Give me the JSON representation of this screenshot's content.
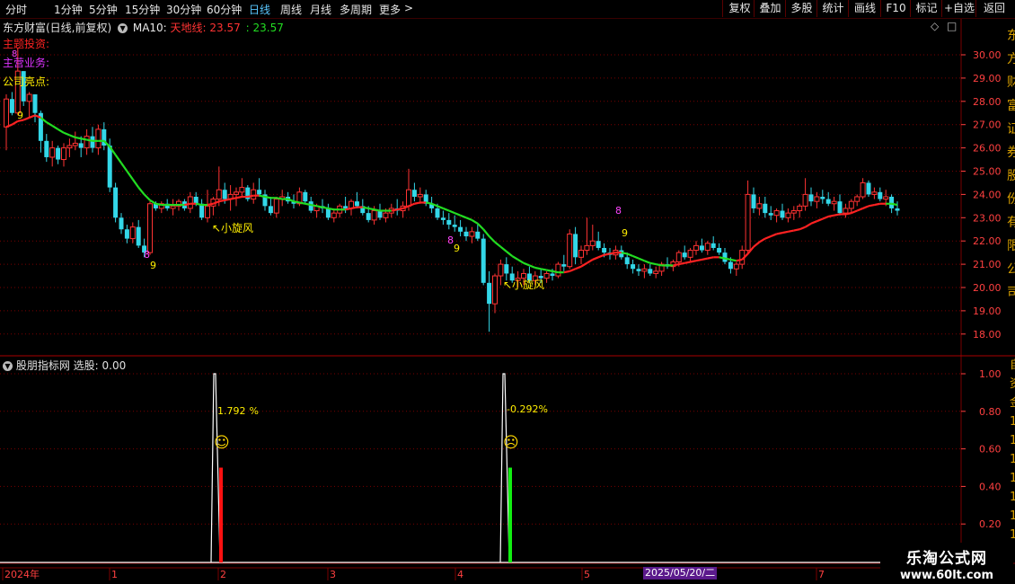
{
  "toolbar": {
    "periods": [
      "分时",
      "1分钟",
      "5分钟",
      "15分钟",
      "30分钟",
      "60分钟",
      "日线",
      "周线",
      "月线",
      "多周期",
      "更多"
    ],
    "active_period": "日线",
    "more_arrow": ">",
    "right_buttons": [
      "复权",
      "叠加",
      "多股",
      "统计",
      "画线",
      "F10",
      "标记",
      "+自选",
      "返回"
    ]
  },
  "chart_header": {
    "stock_title": "东方财富(日线,前复权)",
    "ma_label": "MA10:",
    "tiandi_label": "天地线:",
    "tiandi_value": "23.57",
    "ma_value_sep": ":",
    "ma_value": "23.57",
    "diamond_icon": "◇",
    "box_icon": "□"
  },
  "info_labels": {
    "theme": "主题投资:",
    "business": "主营业务:",
    "highlights": "公司亮点:"
  },
  "right_side_text": [
    "东",
    "方",
    "财",
    "富",
    "证",
    "券",
    "股",
    "份",
    "有",
    "限",
    "公",
    "司"
  ],
  "price_axis": [
    "30.00",
    "29.00",
    "28.00",
    "27.00",
    "26.00",
    "25.00",
    "24.00",
    "23.00",
    "22.00",
    "21.00",
    "20.00",
    "19.00",
    "18.00"
  ],
  "annotations": {
    "nine_top": "9",
    "eight_top": "8",
    "eight_a": "8",
    "nine_a": "9",
    "xuanfeng_a": "↖小旋风",
    "eight_b": "8",
    "nine_b": "9",
    "xuanfeng_b": "↖小旋风",
    "eight_c": "8",
    "nine_c": "9"
  },
  "indicator": {
    "title": "股朋指标网",
    "select_label": "选股:",
    "select_value": "0.00",
    "axis": [
      "1.00",
      "0.80",
      "0.60",
      "0.40",
      "0.20"
    ],
    "signal_a_pct": "1.792",
    "signal_b_pct": "-0.292",
    "pct_unit": "%",
    "smile_icon": "☺",
    "frown_icon": "☹",
    "side_chars": [
      "自",
      "资",
      "金",
      "1",
      "1",
      "1",
      "1",
      "1",
      "1",
      "1"
    ]
  },
  "date_axis": {
    "labels": [
      "2024年",
      "1",
      "2",
      "3",
      "4",
      "5",
      "7"
    ],
    "highlight": "2025/05/20/二"
  },
  "watermark": {
    "line1": "乐淘公式网",
    "line2": "www.60lt.com"
  },
  "colors": {
    "up": "#ff3333",
    "down": "#33d7e8",
    "ma_green": "#22dd22",
    "ma_red": "#ff2222",
    "grid": "#7a0000",
    "axis_text": "#ff4040"
  },
  "candles": [
    [
      26.9,
      28.3,
      25.9,
      28.1
    ],
    [
      28.1,
      28.4,
      27.4,
      27.5
    ],
    [
      27.5,
      30.3,
      27.4,
      29.3
    ],
    [
      29.3,
      29.3,
      27.8,
      28.0
    ],
    [
      28.0,
      28.4,
      27.3,
      28.3
    ],
    [
      28.3,
      28.3,
      27.1,
      27.5
    ],
    [
      27.5,
      27.6,
      25.8,
      26.3
    ],
    [
      26.3,
      26.6,
      25.4,
      25.6
    ],
    [
      25.6,
      26.3,
      25.2,
      26.0
    ],
    [
      26.0,
      26.1,
      25.3,
      25.5
    ],
    [
      25.5,
      26.2,
      25.2,
      26.0
    ],
    [
      26.0,
      26.4,
      25.6,
      26.1
    ],
    [
      26.1,
      26.7,
      25.9,
      26.2
    ],
    [
      26.2,
      26.5,
      25.6,
      26.0
    ],
    [
      26.0,
      26.8,
      25.7,
      26.5
    ],
    [
      26.5,
      26.9,
      25.8,
      26.0
    ],
    [
      26.0,
      27.0,
      25.7,
      26.8
    ],
    [
      26.8,
      27.1,
      25.9,
      26.1
    ],
    [
      26.1,
      26.4,
      24.1,
      24.3
    ],
    [
      24.3,
      24.5,
      22.8,
      23.0
    ],
    [
      23.0,
      23.2,
      22.3,
      22.5
    ],
    [
      22.5,
      22.7,
      21.9,
      22.1
    ],
    [
      22.1,
      22.8,
      21.9,
      22.6
    ],
    [
      22.6,
      22.9,
      21.7,
      21.8
    ],
    [
      21.8,
      22.1,
      21.3,
      21.5
    ],
    [
      21.5,
      23.7,
      21.4,
      23.6
    ],
    [
      23.6,
      23.7,
      23.3,
      23.4
    ],
    [
      23.4,
      23.7,
      23.2,
      23.6
    ],
    [
      23.6,
      23.8,
      23.3,
      23.4
    ],
    [
      23.4,
      23.8,
      23.1,
      23.5
    ],
    [
      23.5,
      23.8,
      23.3,
      23.7
    ],
    [
      23.7,
      23.8,
      23.3,
      23.4
    ],
    [
      23.4,
      24.1,
      23.2,
      23.9
    ],
    [
      23.9,
      24.1,
      23.5,
      23.6
    ],
    [
      23.6,
      23.8,
      22.9,
      23.0
    ],
    [
      23.0,
      24.2,
      22.8,
      23.5
    ],
    [
      23.5,
      23.9,
      23.1,
      23.8
    ],
    [
      23.8,
      25.2,
      23.5,
      24.2
    ],
    [
      24.2,
      24.5,
      23.6,
      23.8
    ],
    [
      23.8,
      24.4,
      23.3,
      24.0
    ],
    [
      24.0,
      24.3,
      23.5,
      24.1
    ],
    [
      24.1,
      24.7,
      23.9,
      24.3
    ],
    [
      24.3,
      24.4,
      23.7,
      23.8
    ],
    [
      23.8,
      24.5,
      23.6,
      24.2
    ],
    [
      24.2,
      24.7,
      23.9,
      24.0
    ],
    [
      24.0,
      24.2,
      23.3,
      23.5
    ],
    [
      23.5,
      23.9,
      23.1,
      23.2
    ],
    [
      23.2,
      23.9,
      23.0,
      23.8
    ],
    [
      23.8,
      24.2,
      23.5,
      23.9
    ],
    [
      23.9,
      24.1,
      23.6,
      23.7
    ],
    [
      23.7,
      24.0,
      23.4,
      23.6
    ],
    [
      23.6,
      24.3,
      23.5,
      24.1
    ],
    [
      24.1,
      24.2,
      23.6,
      23.7
    ],
    [
      23.7,
      23.9,
      23.2,
      23.3
    ],
    [
      23.3,
      23.6,
      23.0,
      23.5
    ],
    [
      23.5,
      23.8,
      23.2,
      23.4
    ],
    [
      23.4,
      23.6,
      22.9,
      23.0
    ],
    [
      23.0,
      23.4,
      22.8,
      23.2
    ],
    [
      23.2,
      23.6,
      23.0,
      23.5
    ],
    [
      23.5,
      23.9,
      23.2,
      23.4
    ],
    [
      23.4,
      23.8,
      23.1,
      23.7
    ],
    [
      23.7,
      24.1,
      23.4,
      23.5
    ],
    [
      23.5,
      23.8,
      23.1,
      23.2
    ],
    [
      23.2,
      23.5,
      22.8,
      22.9
    ],
    [
      22.9,
      23.5,
      22.7,
      23.3
    ],
    [
      23.3,
      23.6,
      22.9,
      23.0
    ],
    [
      23.0,
      23.4,
      22.8,
      23.2
    ],
    [
      23.2,
      23.6,
      23.0,
      23.4
    ],
    [
      23.4,
      23.8,
      23.1,
      23.3
    ],
    [
      23.3,
      23.7,
      23.0,
      23.5
    ],
    [
      23.5,
      25.1,
      23.3,
      24.2
    ],
    [
      24.2,
      24.5,
      23.7,
      23.9
    ],
    [
      23.9,
      24.3,
      23.6,
      24.0
    ],
    [
      24.0,
      24.2,
      23.5,
      23.6
    ],
    [
      23.6,
      23.9,
      23.2,
      23.4
    ],
    [
      23.4,
      23.6,
      22.9,
      23.0
    ],
    [
      23.0,
      23.3,
      22.7,
      22.9
    ],
    [
      22.9,
      23.2,
      22.5,
      22.7
    ],
    [
      22.7,
      23.1,
      22.4,
      22.6
    ],
    [
      22.6,
      22.9,
      22.2,
      22.4
    ],
    [
      22.4,
      22.6,
      22.0,
      22.2
    ],
    [
      22.2,
      22.6,
      21.9,
      22.4
    ],
    [
      22.4,
      22.7,
      22.0,
      22.1
    ],
    [
      22.1,
      22.3,
      20.1,
      20.2
    ],
    [
      20.2,
      20.7,
      18.1,
      19.3
    ],
    [
      19.3,
      20.6,
      18.9,
      20.5
    ],
    [
      20.5,
      21.2,
      20.1,
      21.0
    ],
    [
      21.0,
      21.3,
      20.3,
      20.6
    ],
    [
      20.6,
      20.9,
      20.2,
      20.3
    ],
    [
      20.3,
      20.7,
      20.0,
      20.4
    ],
    [
      20.4,
      20.8,
      20.1,
      20.6
    ],
    [
      20.6,
      20.9,
      20.2,
      20.3
    ],
    [
      20.3,
      20.7,
      20.1,
      20.5
    ],
    [
      20.5,
      20.8,
      20.2,
      20.4
    ],
    [
      20.4,
      20.7,
      20.2,
      20.6
    ],
    [
      20.6,
      20.8,
      20.3,
      20.5
    ],
    [
      20.5,
      21.1,
      20.4,
      21.0
    ],
    [
      21.0,
      21.4,
      20.7,
      20.9
    ],
    [
      20.9,
      22.5,
      20.8,
      22.3
    ],
    [
      22.3,
      22.6,
      21.0,
      21.3
    ],
    [
      21.3,
      21.8,
      21.0,
      21.6
    ],
    [
      21.6,
      23.0,
      21.4,
      21.8
    ],
    [
      21.8,
      22.7,
      21.6,
      22.0
    ],
    [
      22.0,
      22.4,
      21.6,
      21.7
    ],
    [
      21.7,
      21.9,
      21.3,
      21.5
    ],
    [
      21.5,
      21.7,
      21.2,
      21.4
    ],
    [
      21.4,
      21.8,
      21.2,
      21.6
    ],
    [
      21.6,
      21.8,
      21.2,
      21.3
    ],
    [
      21.3,
      21.5,
      20.8,
      21.0
    ],
    [
      21.0,
      21.2,
      20.6,
      20.8
    ],
    [
      20.8,
      21.0,
      20.5,
      20.7
    ],
    [
      20.7,
      21.0,
      20.4,
      20.8
    ],
    [
      20.8,
      21.0,
      20.5,
      20.6
    ],
    [
      20.6,
      20.9,
      20.4,
      20.7
    ],
    [
      20.7,
      21.1,
      20.5,
      21.0
    ],
    [
      21.0,
      21.3,
      20.8,
      20.9
    ],
    [
      20.9,
      21.2,
      20.7,
      21.1
    ],
    [
      21.1,
      21.6,
      20.9,
      21.5
    ],
    [
      21.5,
      21.8,
      21.2,
      21.3
    ],
    [
      21.3,
      21.7,
      21.1,
      21.6
    ],
    [
      21.6,
      22.0,
      21.4,
      21.8
    ],
    [
      21.8,
      22.1,
      21.5,
      21.6
    ],
    [
      21.6,
      22.0,
      21.4,
      21.9
    ],
    [
      21.9,
      22.2,
      21.6,
      21.7
    ],
    [
      21.7,
      21.9,
      21.4,
      21.5
    ],
    [
      21.5,
      21.7,
      21.0,
      21.1
    ],
    [
      21.1,
      21.3,
      20.6,
      20.8
    ],
    [
      20.8,
      21.1,
      20.5,
      21.0
    ],
    [
      21.0,
      21.8,
      20.8,
      21.6
    ],
    [
      21.6,
      24.6,
      21.4,
      24.0
    ],
    [
      24.0,
      24.3,
      23.2,
      23.4
    ],
    [
      23.4,
      23.9,
      23.1,
      23.6
    ],
    [
      23.6,
      23.9,
      23.0,
      23.2
    ],
    [
      23.2,
      23.5,
      22.9,
      23.1
    ],
    [
      23.1,
      23.4,
      22.8,
      23.3
    ],
    [
      23.3,
      23.6,
      22.9,
      23.0
    ],
    [
      23.0,
      23.4,
      22.8,
      23.2
    ],
    [
      23.2,
      23.5,
      22.9,
      23.3
    ],
    [
      23.3,
      23.6,
      23.0,
      23.5
    ],
    [
      23.5,
      24.7,
      23.3,
      24.0
    ],
    [
      24.0,
      24.3,
      23.5,
      23.7
    ],
    [
      23.7,
      24.1,
      23.4,
      23.9
    ],
    [
      23.9,
      24.2,
      23.6,
      23.8
    ],
    [
      23.8,
      24.1,
      23.5,
      23.6
    ],
    [
      23.6,
      23.9,
      23.3,
      23.7
    ],
    [
      23.7,
      24.0,
      23.1,
      23.2
    ],
    [
      23.2,
      23.6,
      23.0,
      23.4
    ],
    [
      23.4,
      23.8,
      23.2,
      23.7
    ],
    [
      23.7,
      24.0,
      23.5,
      23.9
    ],
    [
      23.9,
      24.7,
      23.8,
      24.5
    ],
    [
      24.5,
      24.6,
      23.9,
      24.0
    ],
    [
      24.0,
      24.3,
      23.8,
      24.1
    ],
    [
      24.1,
      24.3,
      23.7,
      23.8
    ],
    [
      23.8,
      24.2,
      23.5,
      23.9
    ],
    [
      23.9,
      24.0,
      23.2,
      23.4
    ],
    [
      23.4,
      23.7,
      23.1,
      23.3
    ]
  ],
  "ma_line": [
    [
      26.9,
      "r"
    ],
    [
      27.0,
      "r"
    ],
    [
      27.15,
      "r"
    ],
    [
      27.2,
      "r"
    ],
    [
      27.3,
      "r"
    ],
    [
      27.4,
      "r"
    ],
    [
      27.3,
      "r"
    ],
    [
      27.1,
      "g"
    ],
    [
      26.95,
      "g"
    ],
    [
      26.8,
      "g"
    ],
    [
      26.65,
      "g"
    ],
    [
      26.55,
      "g"
    ],
    [
      26.45,
      "g"
    ],
    [
      26.4,
      "g"
    ],
    [
      26.35,
      "g"
    ],
    [
      26.3,
      "g"
    ],
    [
      26.3,
      "g"
    ],
    [
      26.3,
      "g"
    ],
    [
      26.05,
      "g"
    ],
    [
      25.7,
      "g"
    ],
    [
      25.35,
      "g"
    ],
    [
      25.0,
      "g"
    ],
    [
      24.65,
      "g"
    ],
    [
      24.3,
      "g"
    ],
    [
      24.0,
      "g"
    ],
    [
      23.75,
      "g"
    ],
    [
      23.6,
      "g"
    ],
    [
      23.55,
      "g"
    ],
    [
      23.55,
      "g"
    ],
    [
      23.55,
      "g"
    ],
    [
      23.55,
      "g"
    ],
    [
      23.55,
      "g"
    ],
    [
      23.6,
      "r"
    ],
    [
      23.6,
      "r"
    ],
    [
      23.55,
      "g"
    ],
    [
      23.55,
      "g"
    ],
    [
      23.6,
      "r"
    ],
    [
      23.7,
      "r"
    ],
    [
      23.75,
      "r"
    ],
    [
      23.8,
      "r"
    ],
    [
      23.85,
      "r"
    ],
    [
      23.9,
      "r"
    ],
    [
      23.9,
      "r"
    ],
    [
      23.95,
      "r"
    ],
    [
      23.95,
      "r"
    ],
    [
      23.9,
      "g"
    ],
    [
      23.85,
      "g"
    ],
    [
      23.85,
      "g"
    ],
    [
      23.8,
      "g"
    ],
    [
      23.8,
      "g"
    ],
    [
      23.7,
      "g"
    ],
    [
      23.65,
      "g"
    ],
    [
      23.6,
      "g"
    ],
    [
      23.55,
      "g"
    ],
    [
      23.5,
      "g"
    ],
    [
      23.45,
      "g"
    ],
    [
      23.4,
      "g"
    ],
    [
      23.35,
      "g"
    ],
    [
      23.35,
      "g"
    ],
    [
      23.35,
      "g"
    ],
    [
      23.4,
      "r"
    ],
    [
      23.45,
      "r"
    ],
    [
      23.45,
      "r"
    ],
    [
      23.4,
      "g"
    ],
    [
      23.35,
      "g"
    ],
    [
      23.3,
      "g"
    ],
    [
      23.3,
      "g"
    ],
    [
      23.3,
      "g"
    ],
    [
      23.35,
      "r"
    ],
    [
      23.4,
      "r"
    ],
    [
      23.5,
      "r"
    ],
    [
      23.6,
      "r"
    ],
    [
      23.65,
      "r"
    ],
    [
      23.65,
      "r"
    ],
    [
      23.6,
      "g"
    ],
    [
      23.5,
      "g"
    ],
    [
      23.4,
      "g"
    ],
    [
      23.3,
      "g"
    ],
    [
      23.2,
      "g"
    ],
    [
      23.1,
      "g"
    ],
    [
      23.0,
      "g"
    ],
    [
      22.9,
      "g"
    ],
    [
      22.75,
      "g"
    ],
    [
      22.5,
      "g"
    ],
    [
      22.2,
      "g"
    ],
    [
      21.95,
      "g"
    ],
    [
      21.75,
      "g"
    ],
    [
      21.55,
      "g"
    ],
    [
      21.35,
      "g"
    ],
    [
      21.2,
      "g"
    ],
    [
      21.05,
      "g"
    ],
    [
      20.95,
      "g"
    ],
    [
      20.85,
      "g"
    ],
    [
      20.8,
      "g"
    ],
    [
      20.75,
      "g"
    ],
    [
      20.7,
      "g"
    ],
    [
      20.65,
      "g"
    ],
    [
      20.65,
      "g"
    ],
    [
      20.7,
      "r"
    ],
    [
      20.8,
      "r"
    ],
    [
      20.9,
      "r"
    ],
    [
      21.05,
      "r"
    ],
    [
      21.2,
      "r"
    ],
    [
      21.3,
      "r"
    ],
    [
      21.4,
      "r"
    ],
    [
      21.45,
      "r"
    ],
    [
      21.5,
      "r"
    ],
    [
      21.5,
      "r"
    ],
    [
      21.45,
      "g"
    ],
    [
      21.35,
      "g"
    ],
    [
      21.25,
      "g"
    ],
    [
      21.15,
      "g"
    ],
    [
      21.05,
      "g"
    ],
    [
      21.0,
      "g"
    ],
    [
      20.95,
      "g"
    ],
    [
      20.95,
      "g"
    ],
    [
      20.95,
      "g"
    ],
    [
      21.0,
      "r"
    ],
    [
      21.05,
      "r"
    ],
    [
      21.1,
      "r"
    ],
    [
      21.15,
      "r"
    ],
    [
      21.2,
      "r"
    ],
    [
      21.25,
      "r"
    ],
    [
      21.3,
      "r"
    ],
    [
      21.3,
      "r"
    ],
    [
      21.25,
      "g"
    ],
    [
      21.2,
      "g"
    ],
    [
      21.15,
      "g"
    ],
    [
      21.2,
      "r"
    ],
    [
      21.45,
      "r"
    ],
    [
      21.75,
      "r"
    ],
    [
      21.95,
      "r"
    ],
    [
      22.1,
      "r"
    ],
    [
      22.2,
      "r"
    ],
    [
      22.3,
      "r"
    ],
    [
      22.35,
      "r"
    ],
    [
      22.4,
      "r"
    ],
    [
      22.45,
      "r"
    ],
    [
      22.5,
      "r"
    ],
    [
      22.6,
      "r"
    ],
    [
      22.75,
      "r"
    ],
    [
      22.85,
      "r"
    ],
    [
      22.95,
      "r"
    ],
    [
      23.05,
      "r"
    ],
    [
      23.1,
      "r"
    ],
    [
      23.15,
      "r"
    ],
    [
      23.15,
      "r"
    ],
    [
      23.2,
      "r"
    ],
    [
      23.3,
      "r"
    ],
    [
      23.4,
      "r"
    ],
    [
      23.5,
      "r"
    ],
    [
      23.55,
      "r"
    ],
    [
      23.6,
      "r"
    ],
    [
      23.6,
      "r"
    ],
    [
      23.6,
      "g"
    ],
    [
      23.55,
      "g"
    ]
  ]
}
